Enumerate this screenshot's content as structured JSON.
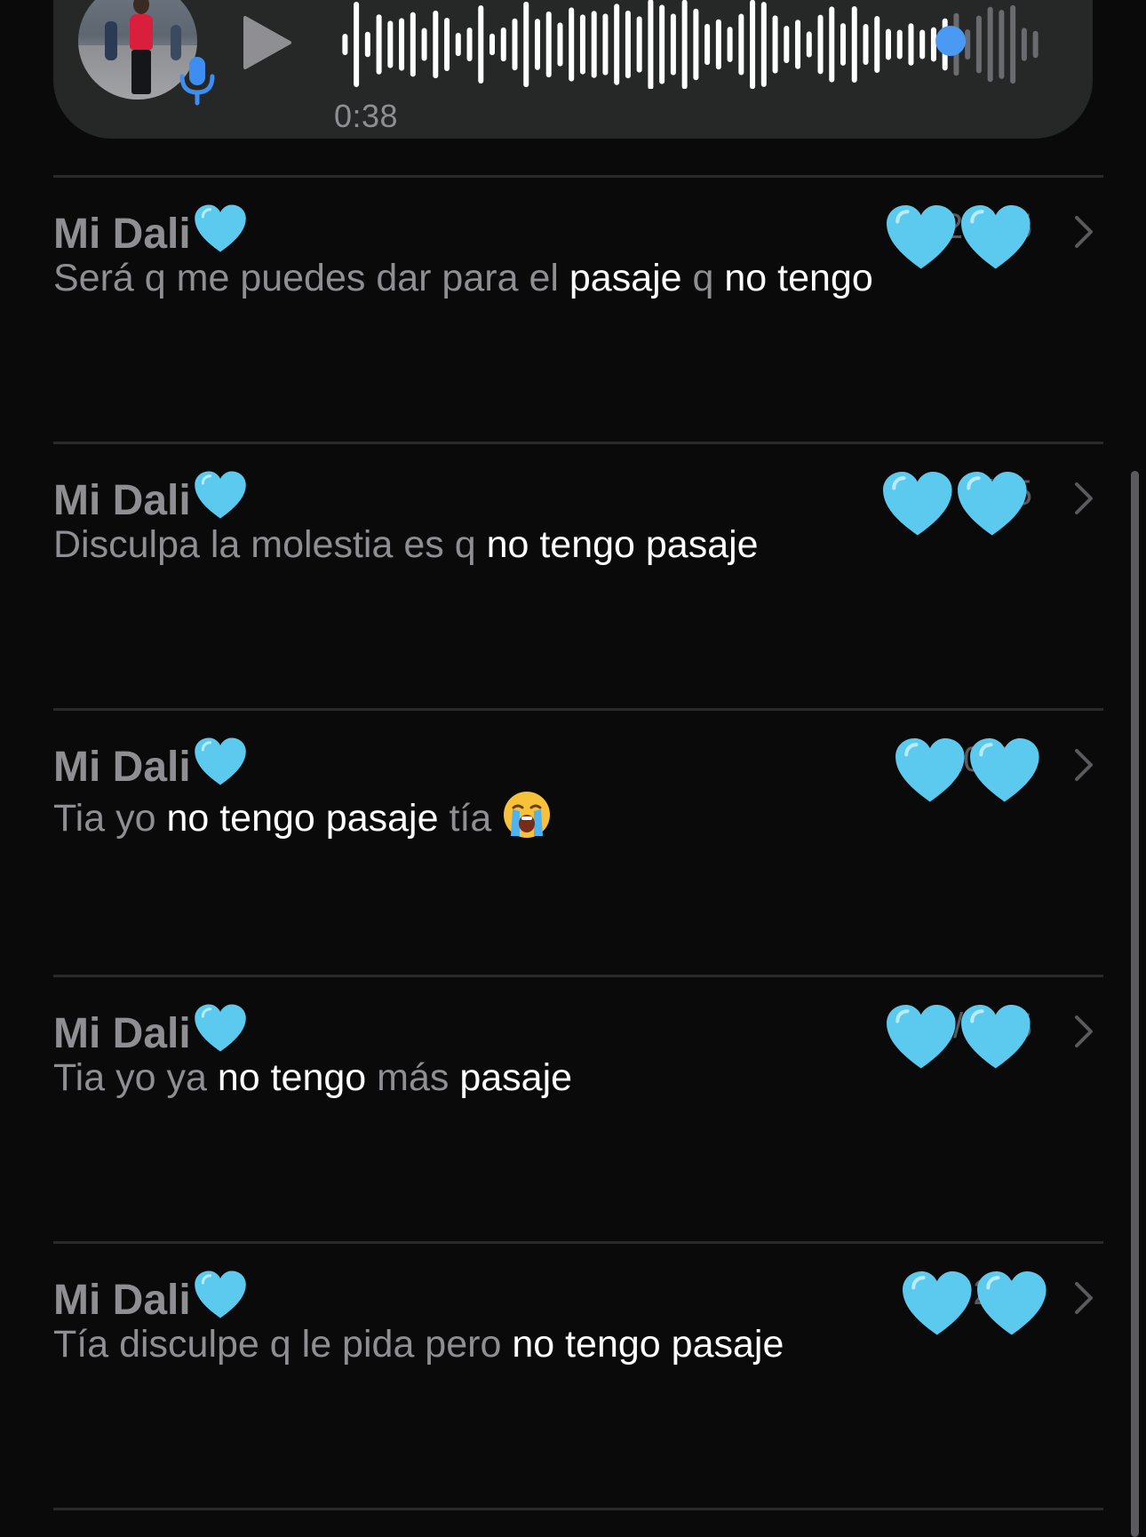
{
  "voice_message": {
    "duration": "0:38",
    "play_icon": "play-icon",
    "mic_icon": "microphone-icon",
    "progress": 0.87,
    "colors": {
      "bubble": "#262727",
      "played_bar": "#ffffff",
      "unplayed_bar": "#6b6b6f",
      "scrubber": "#4a9af4",
      "mic": "#3d8ef0"
    }
  },
  "results": [
    {
      "sender": "Mi Dali",
      "sender_emoji": "light-blue-heart",
      "date": "24/25",
      "snippet": [
        {
          "text": "Será q me puedes dar para el ",
          "hl": false
        },
        {
          "text": "pasaje",
          "hl": true
        },
        {
          "text": " q ",
          "hl": false
        },
        {
          "text": "no tengo",
          "hl": true
        }
      ]
    },
    {
      "sender": "Mi Dali",
      "sender_emoji": "light-blue-heart",
      "date": "2/25",
      "snippet": [
        {
          "text": "Disculpa la molestia es q ",
          "hl": false
        },
        {
          "text": "no tengo pasaje",
          "hl": true
        }
      ]
    },
    {
      "sender": "Mi Dali",
      "sender_emoji": "light-blue-heart",
      "date": "3/10/25",
      "snippet": [
        {
          "text": "Tia yo ",
          "hl": false
        },
        {
          "text": "no tengo pasaje",
          "hl": true
        },
        {
          "text": " tía ",
          "hl": false
        }
      ],
      "trailing_emoji": "loudly-crying-face"
    },
    {
      "sender": "Mi Dali",
      "sender_emoji": "light-blue-heart",
      "date": "1/5/25",
      "snippet": [
        {
          "text": "Tia yo ya ",
          "hl": false
        },
        {
          "text": "no tengo",
          "hl": true
        },
        {
          "text": " más ",
          "hl": false
        },
        {
          "text": "pasaje",
          "hl": true
        }
      ]
    },
    {
      "sender": "Mi Dali",
      "sender_emoji": "light-blue-heart",
      "date": "2/1/",
      "snippet": [
        {
          "text": "Tía disculpe q le pida pero ",
          "hl": false
        },
        {
          "text": "no tengo pasaje",
          "hl": true
        }
      ]
    }
  ],
  "chevron_icon": "chevron-right-icon",
  "colors": {
    "background": "#0a0a0a",
    "divider": "#2a2a2c",
    "muted_text": "#8e8e93",
    "highlight_text": "#ffffff",
    "heart": "#5cc9ee"
  }
}
